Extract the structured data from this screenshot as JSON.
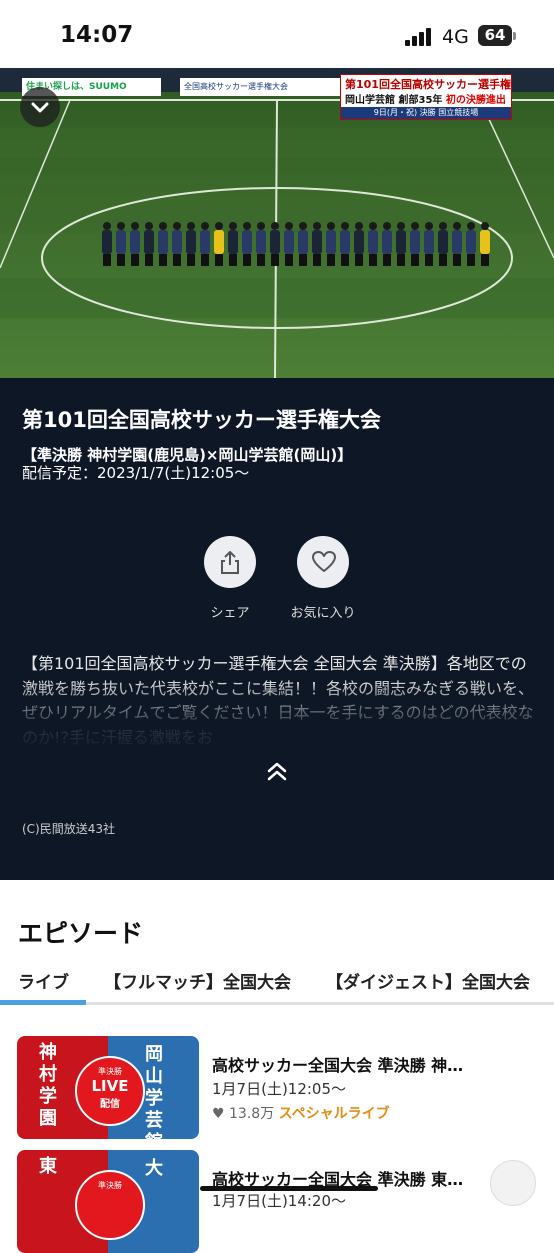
{
  "status_bar": {
    "time": "14:07",
    "network": "4G",
    "battery": "64"
  },
  "video": {
    "banner_left": "住まい探しは、SUUMO",
    "banner_mid": "全国高校サッカー選手権大会",
    "ticker_title": "第101回全国高校サッカー選手権",
    "ticker_team": "岡山学芸館 創部35年",
    "ticker_highlight": "初の決勝進出",
    "ticker_info": "9日(月・祝) 決勝 国立競技場"
  },
  "program": {
    "title": "第101回全国高校サッカー選手権大会",
    "subtitle": "【準決勝 神村学園(鹿児島)×岡山学芸館(岡山)】",
    "schedule": "配信予定：2023/1/7(土)12:05〜",
    "actions": [
      {
        "label": "シェア",
        "icon": "share-icon"
      },
      {
        "label": "お気に入り",
        "icon": "heart-icon"
      }
    ],
    "description": "【第101回全国高校サッカー選手権大会 全国大会 準決勝】各地区での激戦を勝ち抜いた代表校がここに集結！！各校の闘志みなぎる戦いを、ぜひリアルタイムでご覧ください！日本一を手にするのはどの代表校なのか!?手に汗握る激戦をお",
    "copyright": "(C)民間放送43社"
  },
  "episodes": {
    "heading": "エピソード",
    "tabs": [
      "ライブ",
      "【フルマッチ】全国大会",
      "【ダイジェスト】全国大会"
    ],
    "items": [
      {
        "title": "高校サッカー全国大会 準決勝 神…",
        "date": "1月7日(土)12:05〜",
        "views": "13.8万",
        "tag": "スペシャルライブ",
        "thumb_left": "神村学園",
        "thumb_right": "岡山学芸館",
        "badge_top": "準決勝",
        "badge_main": "LIVE",
        "badge_sub": "配信"
      },
      {
        "title": "高校サッカー全国大会 準決勝 東…",
        "date": "1月7日(土)14:20〜",
        "thumb_left": "東",
        "thumb_right": "大",
        "badge_top": "準決勝"
      }
    ]
  },
  "colors": {
    "accent": "#4aa3df",
    "dark_bg": "#0e1726",
    "tag": "#e88a16",
    "live_red": "#e3171e"
  }
}
